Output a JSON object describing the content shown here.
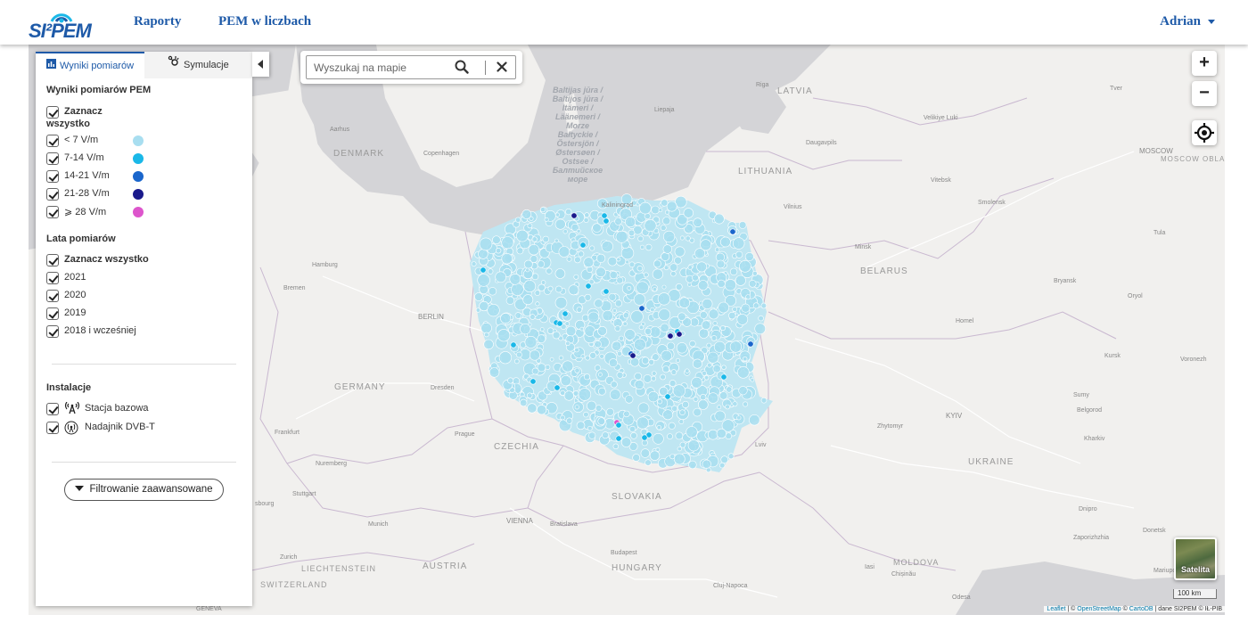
{
  "header": {
    "logo_text": "SI²PEM",
    "nav": [
      {
        "label": "Raporty"
      },
      {
        "label": "PEM w liczbach"
      }
    ],
    "user_name": "Adrian"
  },
  "panel": {
    "tabs": [
      {
        "label": "Wyniki pomiarów",
        "icon": "bar-chart-icon",
        "active": true
      },
      {
        "label": "Symulacje",
        "icon": "simulation-icon",
        "active": false
      }
    ],
    "results_title": "Wyniki pomiarów PEM",
    "select_all_results_line1": "Zaznacz",
    "select_all_results_line2": "wszystko",
    "legend": [
      {
        "label": "< 7 V/m",
        "color": "#a8def0"
      },
      {
        "label": "7-14 V/m",
        "color": "#1ab8e8"
      },
      {
        "label": "14-21 V/m",
        "color": "#1a66cc"
      },
      {
        "label": "21-28 V/m",
        "color": "#1a1a8c"
      },
      {
        "label": "⩾ 28 V/m",
        "color": "#dd55cc"
      }
    ],
    "years_title": "Lata pomiarów",
    "select_all_years": "Zaznacz wszystko",
    "years": [
      "2021",
      "2020",
      "2019",
      "2018 i wcześniej"
    ],
    "installations_title": "Instalacje",
    "installations": [
      {
        "label": "Stacja bazowa",
        "icon": "antenna-icon"
      },
      {
        "label": "Nadajnik DVB-T",
        "icon": "broadcast-icon"
      }
    ],
    "advanced_filter_label": "Filtrowanie zaawansowane"
  },
  "search": {
    "placeholder": "Wyszukaj na mapie"
  },
  "map_controls": {
    "zoom_in": "+",
    "zoom_out": "−",
    "satellite_label": "Satelita",
    "scale_label": "100 km"
  },
  "attribution": {
    "leaflet": "Leaflet",
    "sep1": " | © ",
    "osm": "OpenStreetMap",
    "sep2": " © ",
    "carto": "CartoDB",
    "rest": " | dane SI2PEM © IŁ-PIB"
  },
  "map_labels": {
    "countries": [
      "DENMARK",
      "LATVIA",
      "LITHUANIA",
      "BELARUS",
      "GERMANY",
      "CZECHIA",
      "SLOVAKIA",
      "UKRAINE",
      "AUSTRIA",
      "HUNGARY",
      "LIECHTENSTEIN",
      "SWITZERLAND",
      "MOLDOVA",
      "MOSCOW OBLAST"
    ],
    "cities": [
      "Riga",
      "Tver",
      "Velikiye Luki",
      "Liepaja",
      "Aarhus",
      "Daugavpils",
      "Copenhagen",
      "MOSCOW",
      "Kaliningrad",
      "Vilnius",
      "Vitebsk",
      "Smolensk",
      "Tula",
      "Minsk",
      "Hamburg",
      "Bryansk",
      "Oryol",
      "Bremen",
      "BERLIN",
      "Homel",
      "Kursk",
      "Voronezh",
      "Dresden",
      "Sumy",
      "Belgorod",
      "KYIV",
      "Zhytomyr",
      "Kharkiv",
      "Frankfurt",
      "Prague",
      "Lviv",
      "Nuremberg",
      "Stuttgart",
      "sbourg",
      "Munich",
      "VIENNA",
      "Bratislava",
      "Dnipro",
      "Zurich",
      "Budapest",
      "Zaporizhzhia",
      "Donetsk",
      "Iasi",
      "Chișinău",
      "Cluj-Napoca",
      "Mariupo",
      "Odesa",
      "GENEVA"
    ],
    "sea": "Baltijas jūra / Baltijos jūra / Itämeri / Läänemeri / Morze Bałtyckie / Östersjön / Østersøen / Ostsee / Балтийское море"
  },
  "measurement_colors": {
    "low": "#a8def0",
    "medium": "#1ab8e8",
    "high": "#1a66cc",
    "very_high": "#1a1a8c",
    "extreme": "#dd55cc"
  }
}
